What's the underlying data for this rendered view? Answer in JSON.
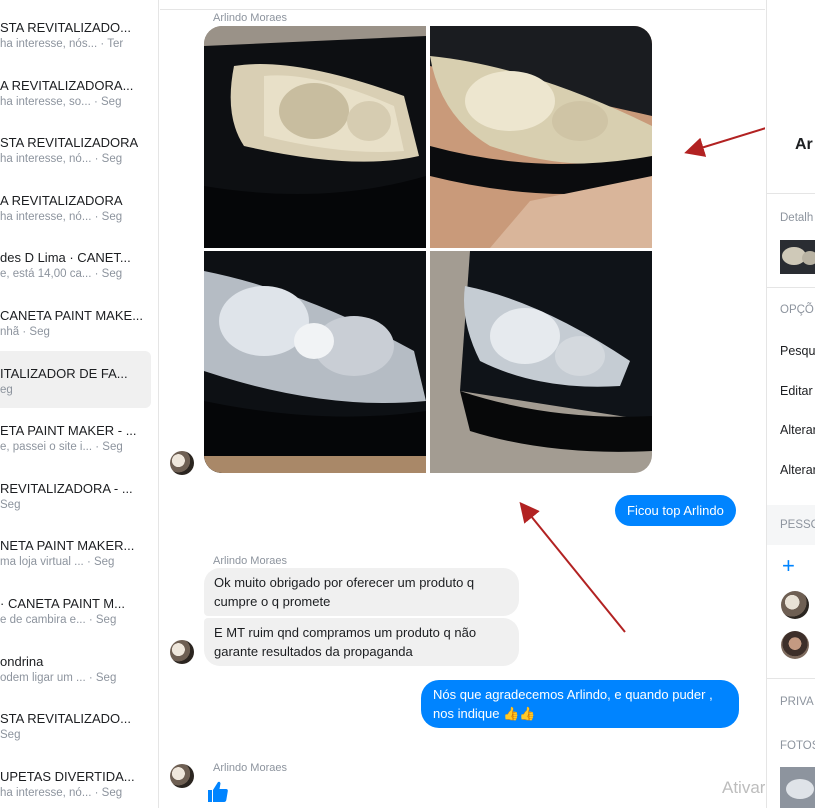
{
  "conversations": [
    {
      "title": "STA REVITALIZADO...",
      "snippet": "ha interesse, nós...",
      "time": "· Ter"
    },
    {
      "title": "A REVITALIZADORA...",
      "snippet": "ha interesse, so...",
      "time": "· Seg"
    },
    {
      "title": "STA REVITALIZADORA",
      "snippet": "ha interesse, nó...",
      "time": "· Seg"
    },
    {
      "title": "A REVITALIZADORA",
      "snippet": "ha interesse, nó...",
      "time": "· Seg"
    },
    {
      "title": "des D Lima · CANET...",
      "snippet": "e, está 14,00 ca...",
      "time": "· Seg"
    },
    {
      "title": "CANETA PAINT MAKE...",
      "snippet": "nhã",
      "time": "· Seg"
    },
    {
      "title": "ITALIZADOR DE FA...",
      "snippet": "eg",
      "time": "",
      "active": true
    },
    {
      "title": "ETA PAINT MAKER - ...",
      "snippet": "e, passei o site i...",
      "time": "· Seg"
    },
    {
      "title": "REVITALIZADORA - ...",
      "snippet": "Seg",
      "time": ""
    },
    {
      "title": "NETA PAINT MAKER...",
      "snippet": "ma loja virtual ...",
      "time": "· Seg"
    },
    {
      "title": "· CANETA PAINT M...",
      "snippet": "e de cambira e...",
      "time": "· Seg"
    },
    {
      "title": "ondrina",
      "snippet": "odem ligar um ...",
      "time": "· Seg"
    },
    {
      "title": "STA REVITALIZADO...",
      "snippet": "Seg",
      "time": ""
    },
    {
      "title": "UPETAS DIVERTIDA...",
      "snippet": "ha interesse, nó...",
      "time": "· Seg"
    }
  ],
  "chat": {
    "sender_name": "Arlindo Moraes",
    "messages_out_1": "Ficou top Arlindo",
    "msg_in_1": "Ok muito obrigado por oferecer um produto q cumpre o q promete",
    "msg_in_2": "E MT ruim qnd compramos um produto q não garante resultados da propaganda",
    "msg_out_2_line1": "Nós que agradecemos Arlindo, e quando puder ,",
    "msg_out_2_line2": "nos indique 👍👍",
    "like_icon": "thumbs-up-icon",
    "accent_color": "#0084ff"
  },
  "watermark": "Ativar o W",
  "right_panel": {
    "title": "Ar",
    "details_label": "Detalh",
    "options_label": "OPÇÕ",
    "options": [
      "Pesqui",
      "Editar",
      "Alterar",
      "Alterar"
    ],
    "people_label": "PESSO",
    "privacy_label": "PRIVA",
    "photos_label": "FOTOS"
  }
}
